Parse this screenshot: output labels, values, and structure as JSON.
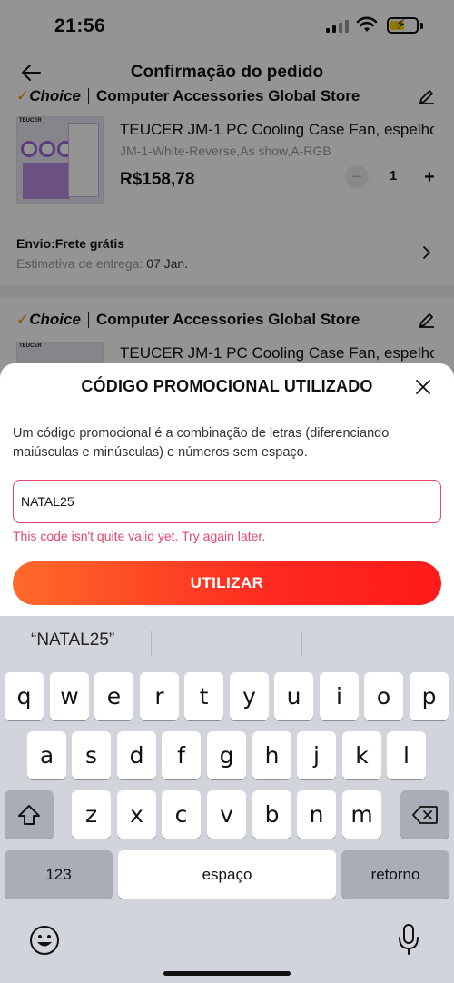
{
  "status_bar": {
    "time": "21:56"
  },
  "nav": {
    "title": "Confirmação do pedido"
  },
  "order": {
    "store1": {
      "badge": "Choice",
      "name": "Computer Accessories Global Store"
    },
    "product1": {
      "title": "TEUCER JM-1 PC Cooling Case Fan, espelho...",
      "variant": "JM-1-White-Reverse,As show,A-RGB",
      "price": "R$158,78",
      "quantity": "1",
      "thumb_brand": "TEUCER"
    },
    "shipping": {
      "label": "Envio:Frete grátis",
      "estimate_label": "Estimativa de entrega:",
      "estimate_date": "07 Jan."
    },
    "store2": {
      "badge": "Choice",
      "name": "Computer Accessories Global Store"
    },
    "product2": {
      "title": "TEUCER JM-1 PC Cooling Case Fan, espelho...",
      "thumb_brand": "TEUCER"
    }
  },
  "promo_sheet": {
    "title": "CÓDIGO PROMOCIONAL UTILIZADO",
    "description": "Um código promocional é a combinação de letras (diferenciando maiúsculas e minúsculas) e números sem espaço.",
    "input_value": "NATAL25",
    "error": "This code isn't quite valid yet. Try again later.",
    "apply_label": "UTILIZAR",
    "colors": {
      "accent_start": "#ff6a2b",
      "accent_end": "#ff1a1a",
      "error": "#e6476b"
    }
  },
  "keyboard": {
    "suggestion": "“NATAL25”",
    "row1": [
      "q",
      "w",
      "e",
      "r",
      "t",
      "y",
      "u",
      "i",
      "o",
      "p"
    ],
    "row2": [
      "a",
      "s",
      "d",
      "f",
      "g",
      "h",
      "j",
      "k",
      "l"
    ],
    "row3": [
      "z",
      "x",
      "c",
      "v",
      "b",
      "n",
      "m"
    ],
    "numbers_key": "123",
    "space_key": "espaço",
    "return_key": "retorno",
    "shift_icon": "shift-icon",
    "delete_icon": "delete-icon"
  }
}
